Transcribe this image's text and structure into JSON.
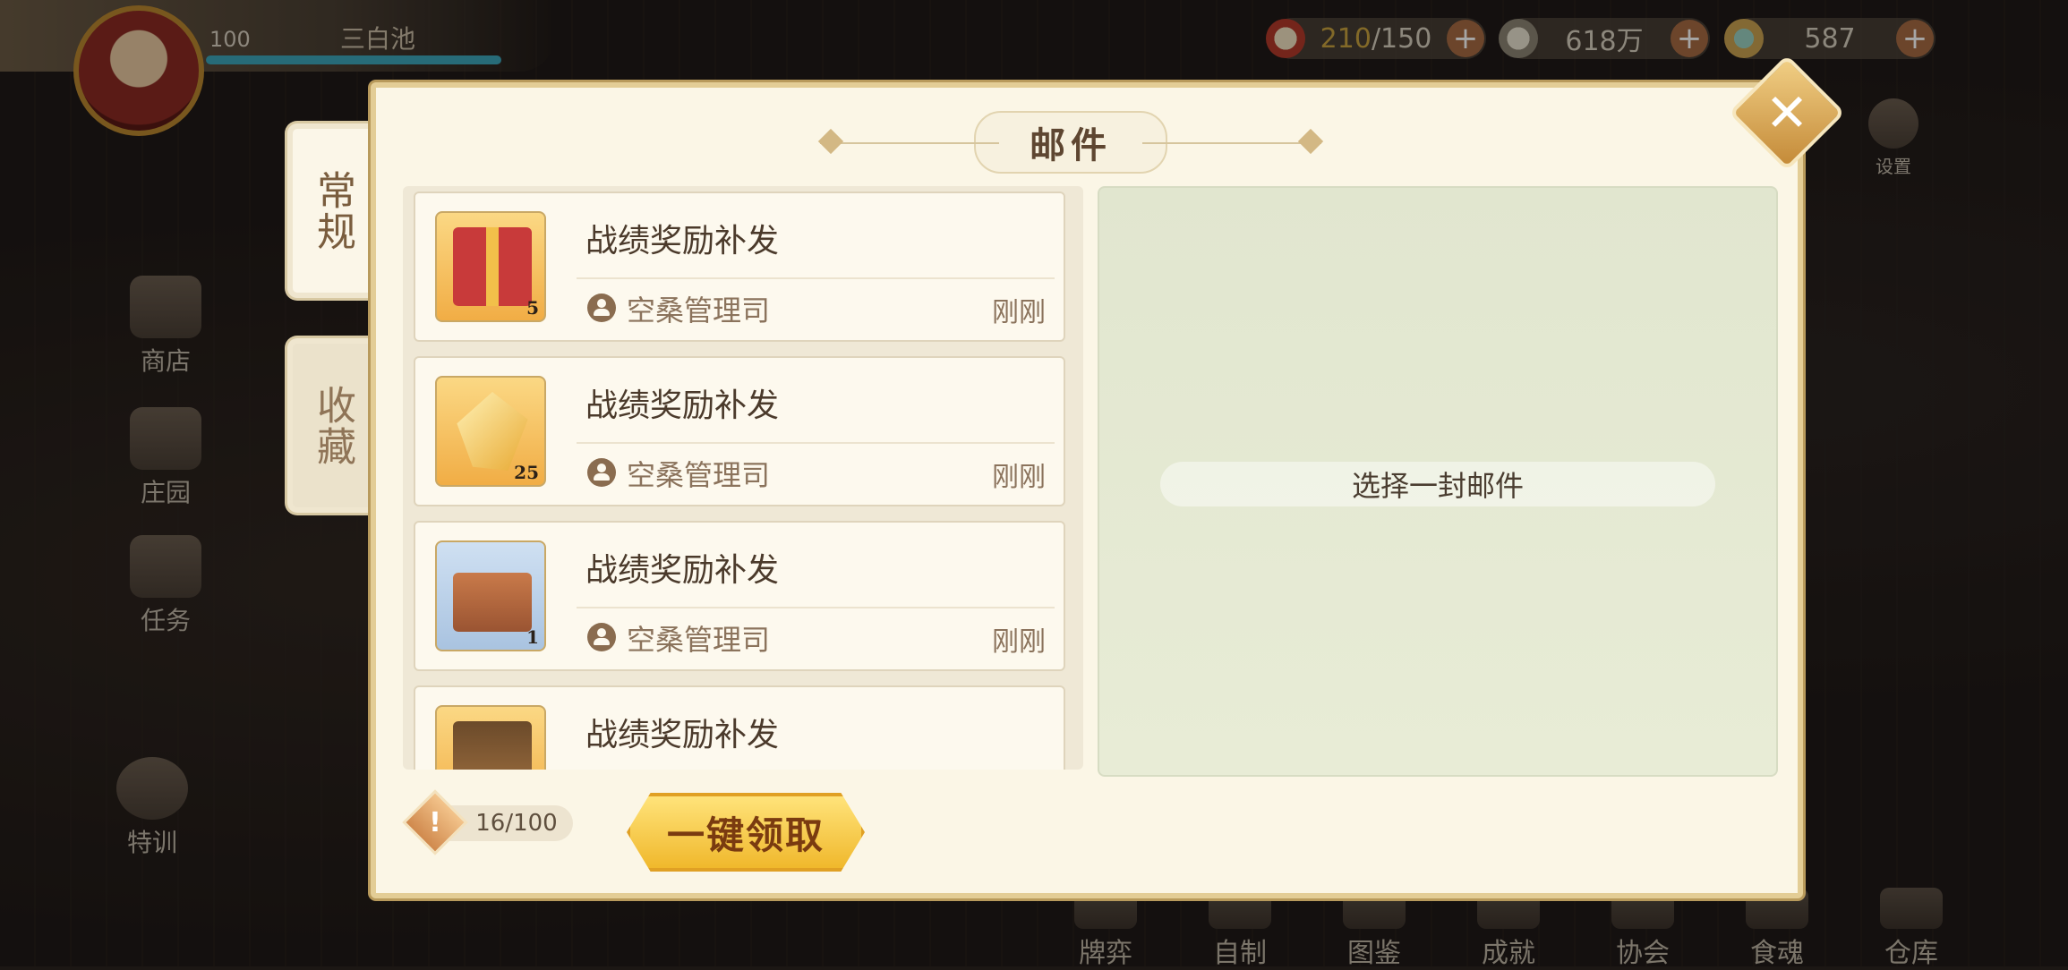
{
  "hud": {
    "level": "100",
    "player_name": "三白池",
    "resources": [
      {
        "icon": "food-bowl-icon",
        "current": "210",
        "max": "/150"
      },
      {
        "icon": "feather-coin-icon",
        "current": "",
        "max": "618万"
      },
      {
        "icon": "jade-gem-icon",
        "current": "",
        "max": "587"
      }
    ],
    "settings_label": "设置",
    "side_buttons": [
      "商店",
      "庄园",
      "任务",
      "特训"
    ],
    "bottom_nav": [
      "牌弈",
      "自制",
      "图鉴",
      "成就",
      "协会",
      "食魂",
      "仓库"
    ]
  },
  "mail": {
    "title": "邮件",
    "tabs": {
      "regular": "常规",
      "favorites": "收藏"
    },
    "items": [
      {
        "title": "战绩奖励补发",
        "sender": "空桑管理司",
        "time": "刚刚",
        "quantity": "5",
        "icon": "gift-box-icon"
      },
      {
        "title": "战绩奖励补发",
        "sender": "空桑管理司",
        "time": "刚刚",
        "quantity": "25",
        "icon": "gold-crystal-icon"
      },
      {
        "title": "战绩奖励补发",
        "sender": "空桑管理司",
        "time": "刚刚",
        "quantity": "1",
        "icon": "food-box-icon"
      },
      {
        "title": "战绩奖励补发",
        "sender": "",
        "time": "",
        "quantity": "",
        "icon": "treasure-chest-icon"
      }
    ],
    "detail_hint": "选择一封邮件",
    "count": "16/100",
    "claim_all": "一键领取"
  },
  "colors": {
    "panel_bg": "#fbf6e6",
    "panel_border": "#e3cd96",
    "claim_button": "#f0b82c",
    "detail_bg": "#e4e9d2"
  }
}
